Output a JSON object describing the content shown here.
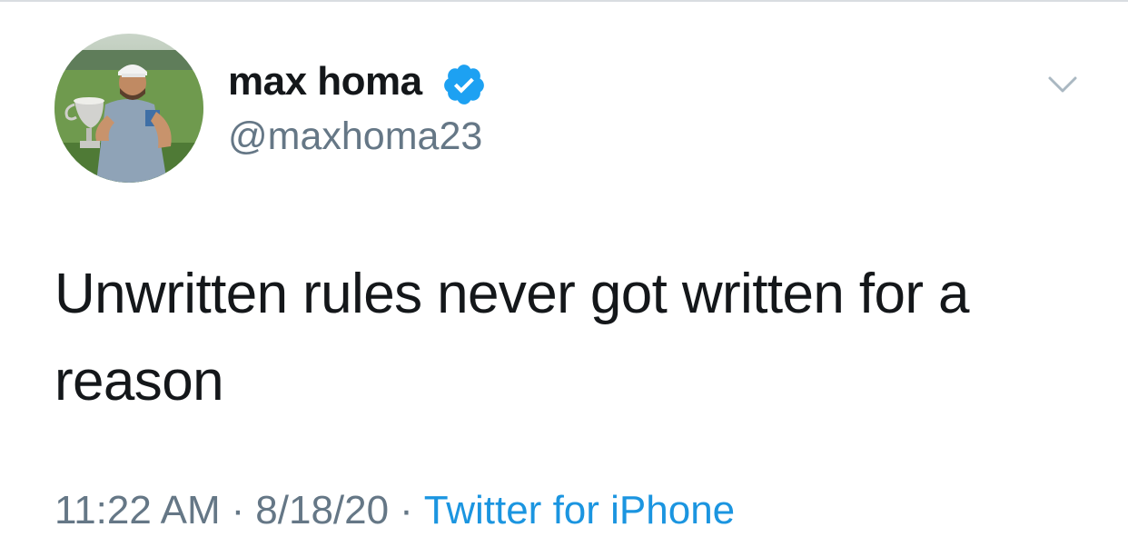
{
  "tweet": {
    "author": {
      "display_name": "max homa",
      "handle": "@maxhoma23",
      "verified": true
    },
    "text": "Unwritten rules never got written for a reason",
    "timestamp": {
      "time": "11:22 AM",
      "date": "8/18/20",
      "separator": "·",
      "source": "Twitter for iPhone"
    }
  },
  "colors": {
    "text_primary": "#14171a",
    "text_secondary": "#657786",
    "link_blue": "#1b95e0",
    "verified_blue": "#1da1f2"
  },
  "icons": {
    "verified": "verified-badge-icon",
    "menu": "chevron-down-icon"
  }
}
